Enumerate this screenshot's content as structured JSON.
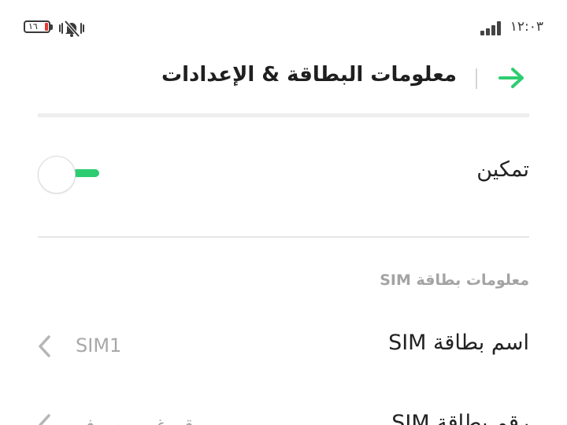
{
  "status_bar": {
    "time": "١٢:٠٣",
    "battery_level": "١٦",
    "icons": [
      "signal-icon",
      "vibrate-muted-bell-icon",
      "battery-icon"
    ]
  },
  "header": {
    "title": "معلومات البطاقة & الإعدادات",
    "back_icon": "arrow-right-icon"
  },
  "enable": {
    "label": "تمكين",
    "toggle_on": true
  },
  "sim_section": {
    "label": "معلومات بطاقة SIM",
    "rows": [
      {
        "label": "اسم بطاقة SIM",
        "value": "SIM1"
      },
      {
        "label": "رقم بطاقة SIM",
        "value": "رقم غير معروف"
      }
    ]
  },
  "colors": {
    "accent": "#2ecc71",
    "battery_low": "#e53935",
    "muted_text": "#a8a8a8"
  }
}
